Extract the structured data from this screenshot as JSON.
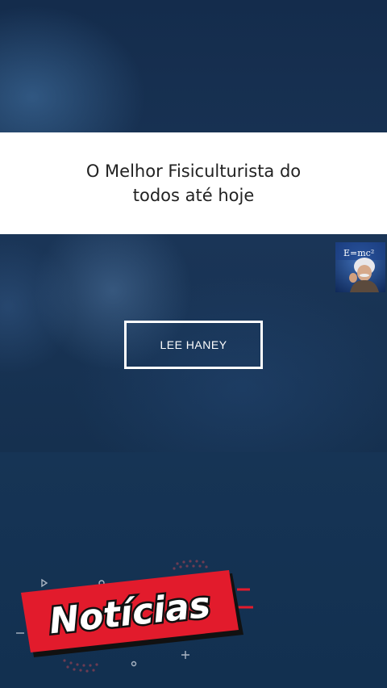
{
  "title": {
    "line1": "O Melhor Fisiculturista do",
    "line2": "todos até hoje"
  },
  "answer_button": {
    "label": "LEE HANEY"
  },
  "avatar": {
    "formula_text": "E=mc²"
  },
  "news_badge": {
    "label": "Notícias"
  },
  "colors": {
    "background": "#15304f",
    "title_band": "#ffffff",
    "title_text": "#222222",
    "badge_red": "#e21b2c",
    "badge_outline": "#111111"
  }
}
